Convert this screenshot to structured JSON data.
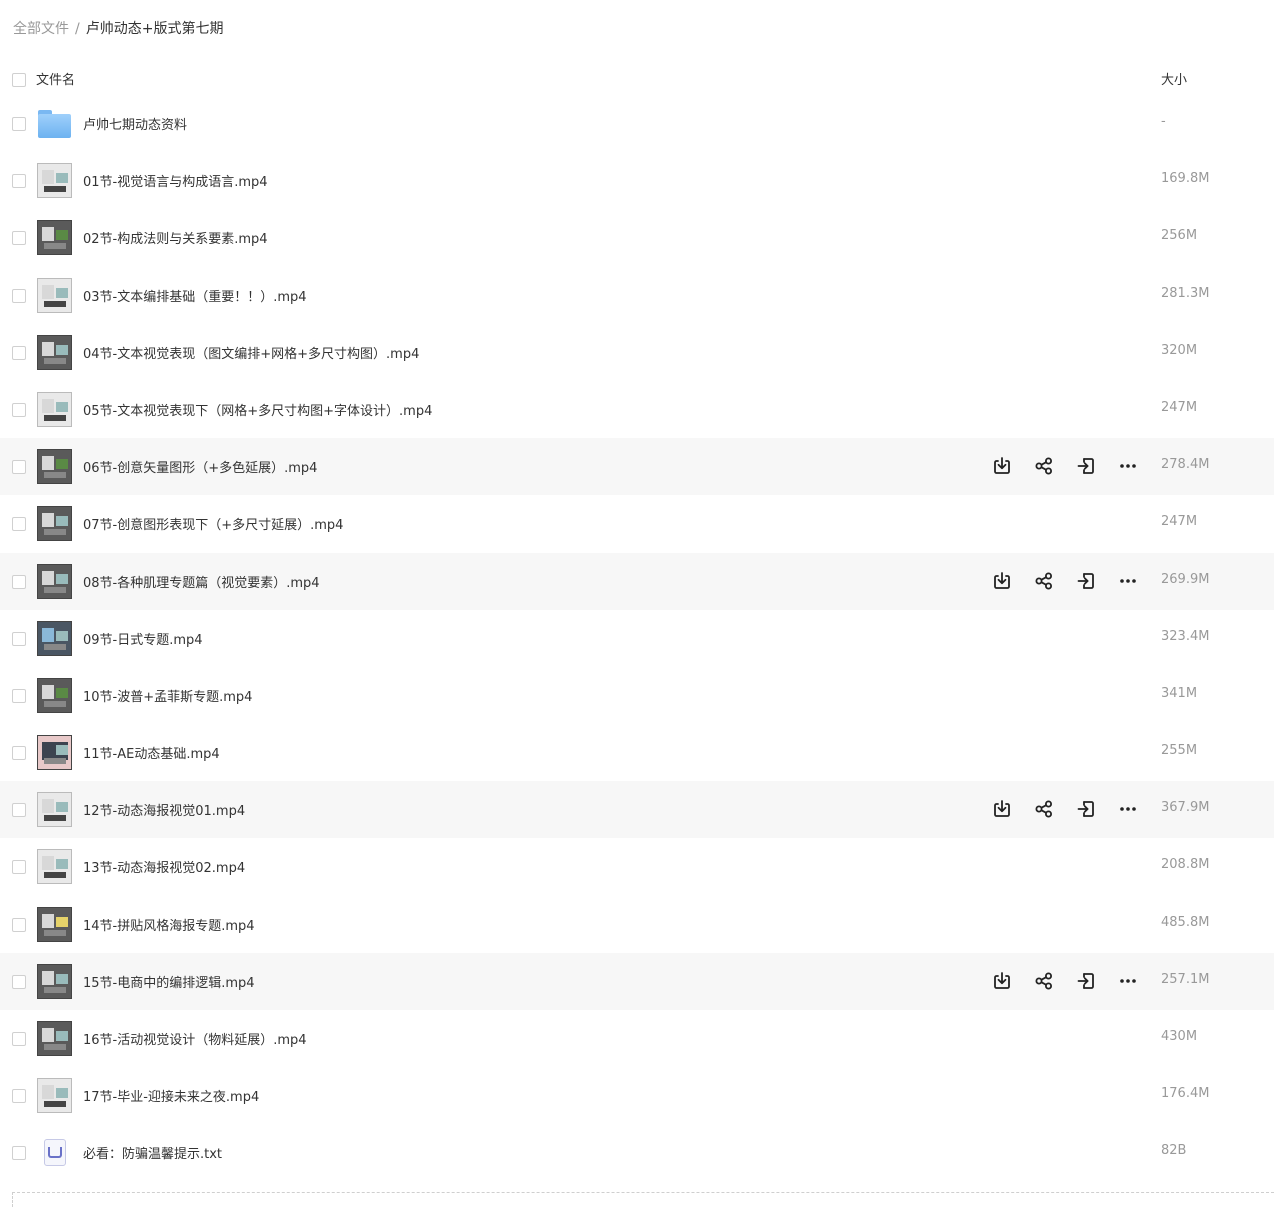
{
  "breadcrumb": {
    "root": "全部文件",
    "separator": "/",
    "current": "卢帅动态+版式第七期"
  },
  "header": {
    "name_label": "文件名",
    "size_label": "大小"
  },
  "icons": {
    "download": "download-icon",
    "share": "share-icon",
    "move": "move-icon",
    "more": "more-icon"
  },
  "files": [
    {
      "name": "卢帅七期动态资料",
      "size": "-",
      "type": "folder",
      "thumb": "folder"
    },
    {
      "name": "01节-视觉语言与构成语言.mp4",
      "size": "169.8M",
      "type": "video",
      "thumb": "light"
    },
    {
      "name": "02节-构成法则与关系要素.mp4",
      "size": "256M",
      "type": "video",
      "thumb": "green"
    },
    {
      "name": "03节-文本编排基础（重要！！）.mp4",
      "size": "281.3M",
      "type": "video",
      "thumb": "light"
    },
    {
      "name": "04节-文本视觉表现（图文编排+网格+多尺寸构图）.mp4",
      "size": "320M",
      "type": "video",
      "thumb": "dark"
    },
    {
      "name": "05节-文本视觉表现下（网格+多尺寸构图+字体设计）.mp4",
      "size": "247M",
      "type": "video",
      "thumb": "light"
    },
    {
      "name": "06节-创意矢量图形（+多色延展）.mp4",
      "size": "278.4M",
      "type": "video",
      "thumb": "green",
      "hover": true
    },
    {
      "name": "07节-创意图形表现下（+多尺寸延展）.mp4",
      "size": "247M",
      "type": "video",
      "thumb": "dark"
    },
    {
      "name": "08节-各种肌理专题篇（视觉要素）.mp4",
      "size": "269.9M",
      "type": "video",
      "thumb": "dark",
      "hover": true
    },
    {
      "name": "09节-日式专题.mp4",
      "size": "323.4M",
      "type": "video",
      "thumb": "blue"
    },
    {
      "name": "10节-波普+孟菲斯专题.mp4",
      "size": "341M",
      "type": "video",
      "thumb": "green"
    },
    {
      "name": "11节-AE动态基础.mp4",
      "size": "255M",
      "type": "video",
      "thumb": "pink"
    },
    {
      "name": "12节-动态海报视觉01.mp4",
      "size": "367.9M",
      "type": "video",
      "thumb": "light",
      "hover": true
    },
    {
      "name": "13节-动态海报视觉02.mp4",
      "size": "208.8M",
      "type": "video",
      "thumb": "light"
    },
    {
      "name": "14节-拼贴风格海报专题.mp4",
      "size": "485.8M",
      "type": "video",
      "thumb": "yellow"
    },
    {
      "name": "15节-电商中的编排逻辑.mp4",
      "size": "257.1M",
      "type": "video",
      "thumb": "dark",
      "hover": true
    },
    {
      "name": "16节-活动视觉设计（物料延展）.mp4",
      "size": "430M",
      "type": "video",
      "thumb": "dark"
    },
    {
      "name": "17节-毕业-迎接未来之夜.mp4",
      "size": "176.4M",
      "type": "video",
      "thumb": "light"
    },
    {
      "name": "必看：防骗温馨提示.txt",
      "size": "82B",
      "type": "txt",
      "thumb": "txt"
    }
  ]
}
